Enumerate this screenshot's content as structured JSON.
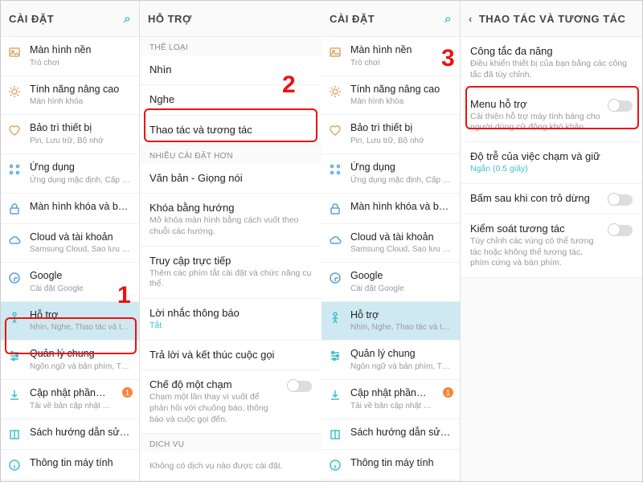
{
  "left": {
    "settings_title": "CÀI ĐẶT",
    "support_title": "HỖ TRỢ",
    "sidebar": [
      {
        "k": "wallpaper",
        "label": "Màn hình nền",
        "sub": "Trò chơi",
        "icon": "image"
      },
      {
        "k": "advanced",
        "label": "Tính năng nâng cao",
        "sub": "Màn hình khóa",
        "icon": "gear"
      },
      {
        "k": "maintenance",
        "label": "Bảo trì thiết bị",
        "sub": "Pin, Lưu trữ, Bộ nhớ",
        "icon": "heart"
      },
      {
        "k": "apps",
        "label": "Ứng dụng",
        "sub": "Ứng dụng mặc định, Cấp qu…",
        "icon": "grid",
        "blue": true
      },
      {
        "k": "lockscreen",
        "label": "Màn hình khóa và b…",
        "sub": "",
        "icon": "lock",
        "blue": true
      },
      {
        "k": "cloud",
        "label": "Cloud và tài khoản",
        "sub": "Samsung Cloud, Sao lưu v…",
        "icon": "cloud",
        "blue": true
      },
      {
        "k": "google",
        "label": "Google",
        "sub": "Cài đặt Google",
        "icon": "g",
        "blue": true
      },
      {
        "k": "accessibility",
        "label": "Hỗ trợ",
        "sub": "Nhìn, Nghe, Thao tác và tươ…",
        "icon": "person",
        "teal": true,
        "sel": true
      },
      {
        "k": "general",
        "label": "Quản lý chung",
        "sub": "Ngôn ngữ và bản phím, Thờ…",
        "icon": "sliders",
        "teal": true
      },
      {
        "k": "update",
        "label": "Cập nhật phần…",
        "sub": "Tải về bản cập nhật thủ c…",
        "icon": "download",
        "teal": true,
        "badge": "1"
      },
      {
        "k": "manual",
        "label": "Sách hướng dẫn sử…",
        "sub": "",
        "icon": "book",
        "teal": true
      },
      {
        "k": "about",
        "label": "Thông tin máy tính",
        "sub": "",
        "icon": "info",
        "teal": true
      }
    ],
    "sect_category": "THỂ LOẠI",
    "sect_more": "NHIỀU CÀI ĐẶT HƠN",
    "sect_services": "DỊCH VỤ",
    "categories": [
      {
        "label": "Nhìn"
      },
      {
        "label": "Nghe"
      },
      {
        "label": "Thao tác và tương tác"
      }
    ],
    "more": [
      {
        "label": "Văn bản - Giọng nói"
      },
      {
        "label": "Khóa bằng hướng",
        "sub": "Mở khóa màn hình bằng cách vuốt theo chuỗi các hướng."
      },
      {
        "label": "Truy cập trực tiếp",
        "sub": "Thêm các phím tắt cài đặt và chức năng cụ thể."
      },
      {
        "label": "Lời nhắc thông báo",
        "sub": "Tắt",
        "off": true
      },
      {
        "label": "Trả lời và kết thúc cuộc gọi"
      },
      {
        "label": "Chế độ một chạm",
        "sub": "Chạm một lần thay vì vuốt để phản hồi với chuông báo, thông báo và cuộc gọi đến.",
        "toggle": true
      }
    ],
    "services_empty": "Không có dịch vụ nào được cài đặt."
  },
  "right": {
    "settings_title": "CÀI ĐẶT",
    "detail_title": "THAO TÁC VÀ TƯƠNG TÁC",
    "items": [
      {
        "label": "Công tắc đa năng",
        "sub": "Điều khiển thiết bị của bạn bằng các công tắc đã tùy chỉnh."
      },
      {
        "label": "Menu hỗ trợ",
        "sub": "Cải thiện hỗ trợ máy tính bảng cho người dùng cử động khó khăn.",
        "toggle": true
      },
      {
        "label": "Độ trễ của việc chạm và giữ",
        "sub": "Ngắn (0.5 giây)",
        "off": true
      },
      {
        "label": "Bấm sau khi con trỏ dừng",
        "toggle": true
      },
      {
        "label": "Kiểm soát tương tác",
        "sub": "Tùy chỉnh các vùng có thể tương tác hoặc không thể tương tác, phím cứng và bàn phím.",
        "toggle": true
      }
    ]
  },
  "annotations": {
    "n1": "1",
    "n2": "2",
    "n3": "3"
  }
}
